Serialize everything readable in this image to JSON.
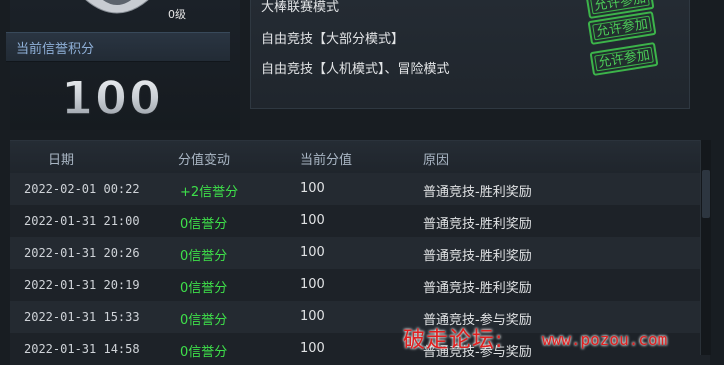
{
  "credit": {
    "level": "0级",
    "label": "当前信誉积分",
    "score": "100"
  },
  "modes": [
    {
      "name": "大棒联赛模式",
      "status": "允许参加"
    },
    {
      "name": "自由竞技【大部分模式】",
      "status": "允许参加"
    },
    {
      "name": "自由竞技【人机模式】、冒险模式",
      "status": "允许参加"
    }
  ],
  "history": {
    "headers": {
      "date": "日期",
      "change": "分值变动",
      "score": "当前分值",
      "reason": "原因"
    },
    "rows": [
      {
        "date": "2022-02-01 00:22",
        "change": "+2信誉分",
        "score": "100",
        "reason": "普通竞技-胜利奖励"
      },
      {
        "date": "2022-01-31 21:00",
        "change": "0信誉分",
        "score": "100",
        "reason": "普通竞技-胜利奖励"
      },
      {
        "date": "2022-01-31 20:26",
        "change": "0信誉分",
        "score": "100",
        "reason": "普通竞技-胜利奖励"
      },
      {
        "date": "2022-01-31 20:19",
        "change": "0信誉分",
        "score": "100",
        "reason": "普通竞技-胜利奖励"
      },
      {
        "date": "2022-01-31 15:33",
        "change": "0信誉分",
        "score": "100",
        "reason": "普通竞技-参与奖励"
      },
      {
        "date": "2022-01-31 14:58",
        "change": "0信誉分",
        "score": "100",
        "reason": "普通竞技-参与奖励"
      }
    ]
  },
  "watermark": {
    "text": "破走论坛:",
    "url": "www.pozou.com"
  },
  "colors": {
    "accent_green": "#3ee04a",
    "stamp_green": "#3cb44a",
    "label_blue": "#8fb0d8",
    "watermark_red": "#e02020"
  }
}
